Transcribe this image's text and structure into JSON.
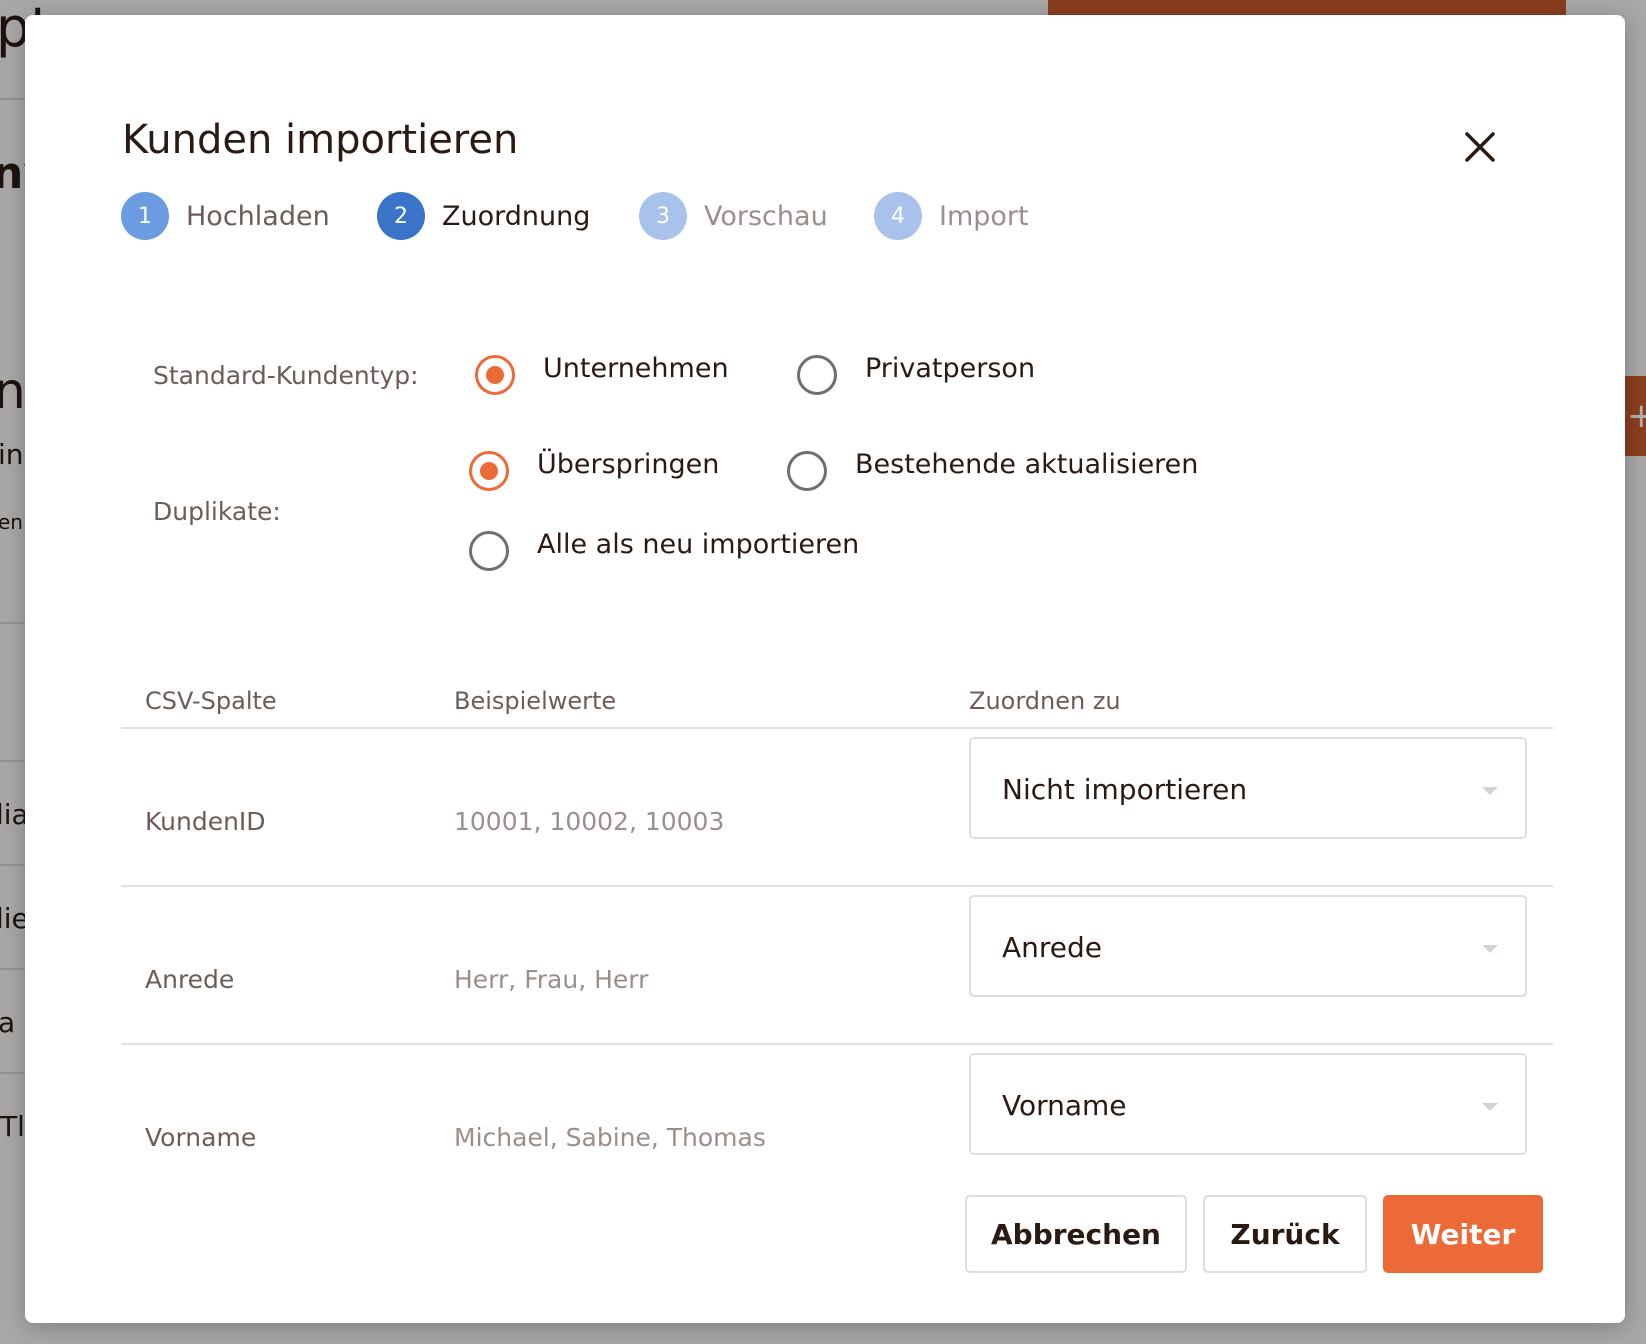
{
  "modal": {
    "title": "Kunden importieren",
    "steps": [
      {
        "number": "1",
        "label": "Hochladen",
        "state": "completed"
      },
      {
        "number": "2",
        "label": "Zuordnung",
        "state": "active"
      },
      {
        "number": "3",
        "label": "Vorschau",
        "state": "pending"
      },
      {
        "number": "4",
        "label": "Import",
        "state": "pending"
      }
    ],
    "options": {
      "customer_type": {
        "label": "Standard-Kundentyp:",
        "choices": [
          "Unternehmen",
          "Privatperson"
        ],
        "selected": "Unternehmen"
      },
      "duplicates": {
        "label": "Duplikate:",
        "choices": [
          "Überspringen",
          "Bestehende aktualisieren",
          "Alle als neu importieren"
        ],
        "selected": "Überspringen"
      }
    },
    "table": {
      "headers": [
        "CSV-Spalte",
        "Beispielwerte",
        "Zuordnen zu"
      ],
      "rows": [
        {
          "column": "KundenID",
          "examples": "10001, 10002, 10003",
          "mapping": "Nicht importieren"
        },
        {
          "column": "Anrede",
          "examples": "Herr, Frau, Herr",
          "mapping": "Anrede"
        },
        {
          "column": "Vorname",
          "examples": "Michael, Sabine, Thomas",
          "mapping": "Vorname"
        }
      ]
    },
    "buttons": {
      "cancel": "Abbrechen",
      "back": "Zurück",
      "next": "Weiter"
    }
  },
  "colors": {
    "accent": "#ec6a38",
    "step_active": "#3a74c9",
    "step_completed": "#6b9be0",
    "step_pending": "#a9c2ec",
    "text_dark": "#2a1a14",
    "text_muted": "#6b5d57"
  },
  "icons": {
    "close": "close-icon",
    "dropdown": "chevron-down-icon"
  },
  "background": {
    "fragments": [
      "ptc",
      "nv",
      "n",
      "in",
      "en",
      "lia",
      "lie",
      "a",
      "Tl",
      "+"
    ]
  }
}
